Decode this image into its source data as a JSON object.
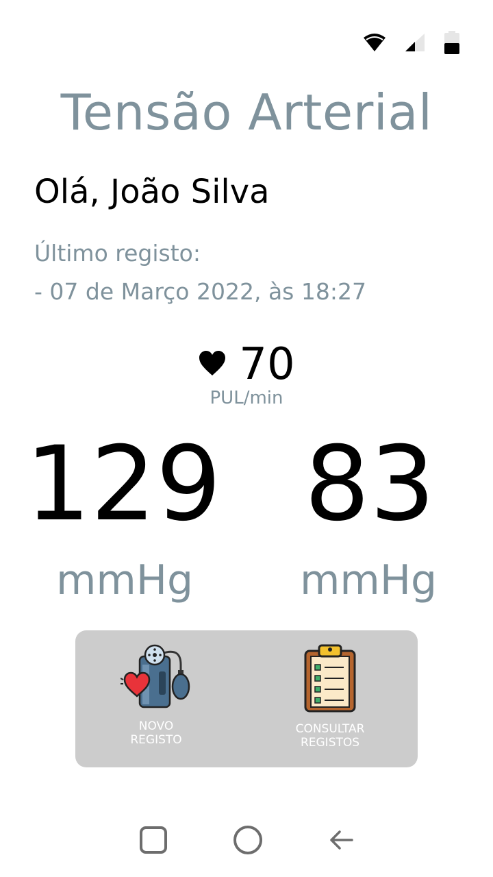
{
  "status_bar": {
    "icons": [
      "wifi-icon",
      "cellular-signal-icon",
      "battery-icon"
    ]
  },
  "app": {
    "title": "Tensão Arterial"
  },
  "greeting": "Olá, João Silva",
  "last_record": {
    "label": "Último registo:",
    "date": "- 07 de Março 2022, às 18:27"
  },
  "pulse": {
    "icon": "heart-icon",
    "value": "70",
    "unit": "PUL/min"
  },
  "blood_pressure": {
    "systolic": "129",
    "diastolic": "83",
    "systolic_unit": "mmHg",
    "diastolic_unit": "mmHg"
  },
  "actions": {
    "new_record_label": "NOVO\nREGISTO",
    "new_record_icon": "blood-pressure-monitor-icon",
    "view_records_label": "CONSULTAR\nREGISTOS",
    "view_records_icon": "clipboard-checklist-icon"
  },
  "nav": {
    "icons": [
      "recent-apps-icon",
      "home-icon",
      "back-icon"
    ]
  },
  "colors": {
    "muted_text": "#7f929c",
    "panel_bg": "#cccccc",
    "primary_text": "#000000"
  }
}
